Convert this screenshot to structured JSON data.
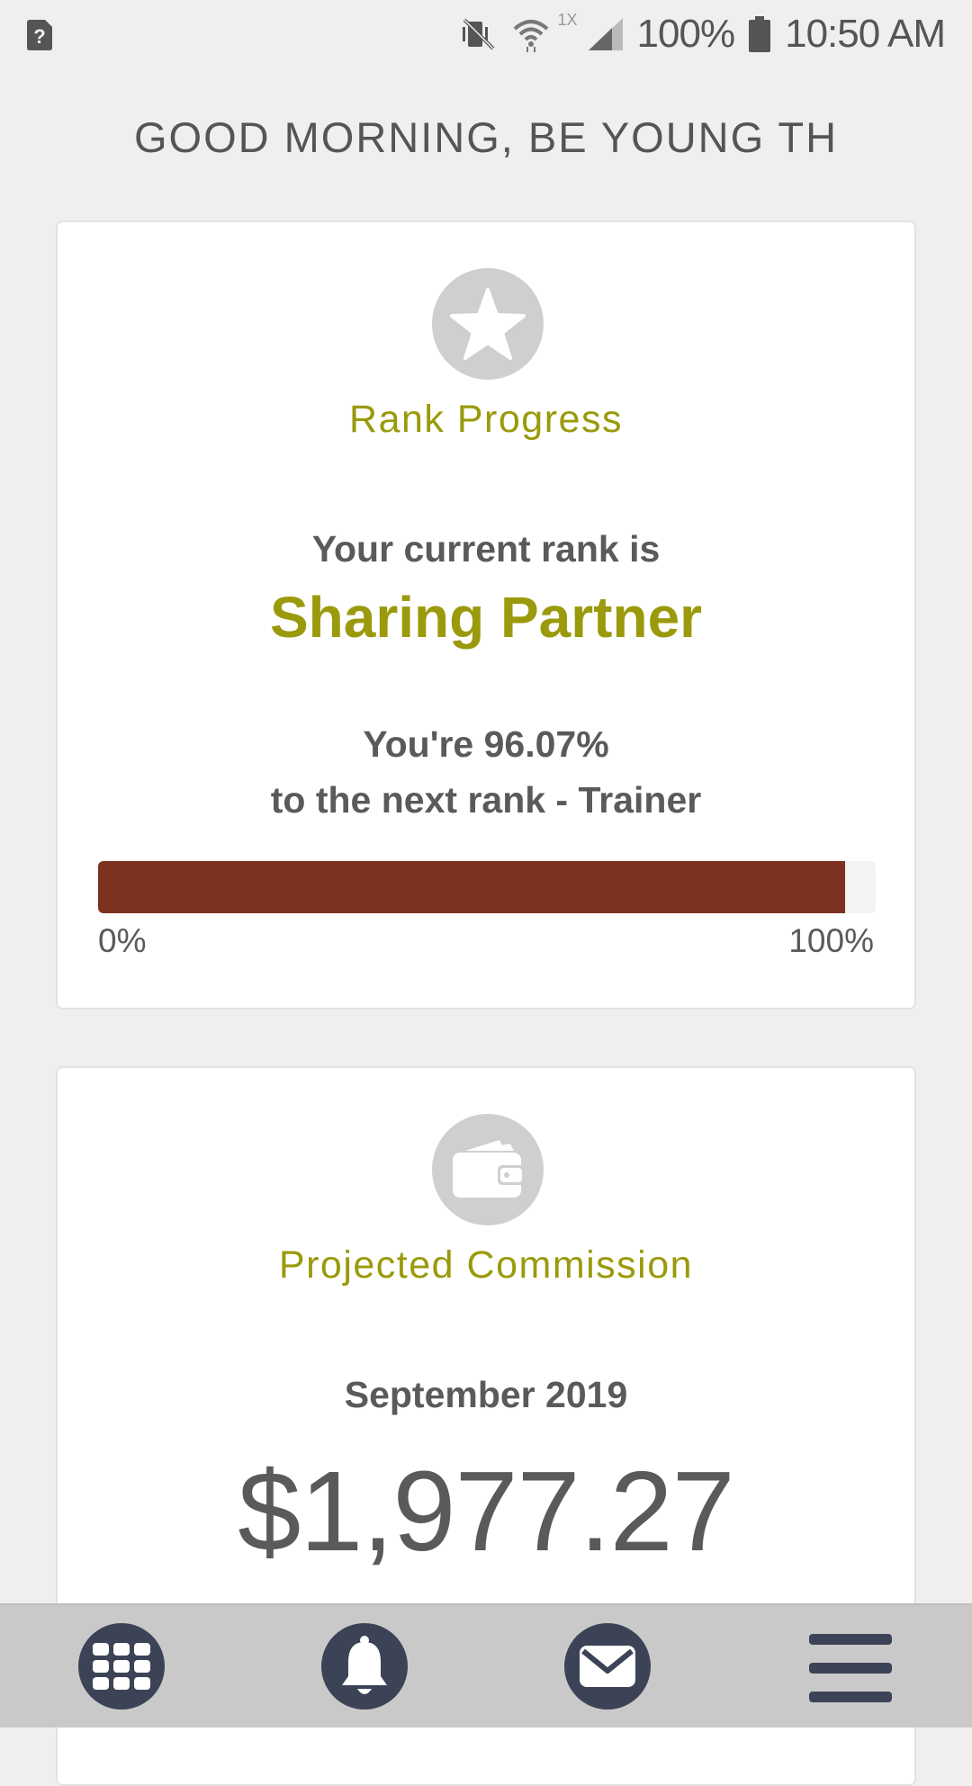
{
  "status_bar": {
    "battery": "100%",
    "time": "10:50 AM",
    "network_label": "1X",
    "icons": [
      "unknown-notification-icon",
      "mute-vibrate-icon",
      "wifi-icon",
      "signal-icon",
      "battery-icon"
    ]
  },
  "greeting": "GOOD MORNING, BE YOUNG TH",
  "rank_card": {
    "icon": "star-icon",
    "title": "Rank Progress",
    "current_rank_label": "Your current rank is",
    "current_rank": "Sharing Partner",
    "progress_text": "You're 96.07%",
    "next_rank_text": "to the next rank - Trainer",
    "progress_percent": 96.07,
    "progress_min_label": "0%",
    "progress_max_label": "100%"
  },
  "commission_card": {
    "icon": "wallet-icon",
    "title": "Projected Commission",
    "period": "September 2019",
    "amount": "$1,977.27"
  },
  "bottom_nav": {
    "items": [
      "apps-grid-icon",
      "bell-icon",
      "mail-icon",
      "hamburger-menu-icon"
    ]
  },
  "colors": {
    "accent": "#9a9a0c",
    "progress_fill": "#7d3220",
    "nav_icon": "#3d4356",
    "icon_circle": "#cfcfcf"
  }
}
